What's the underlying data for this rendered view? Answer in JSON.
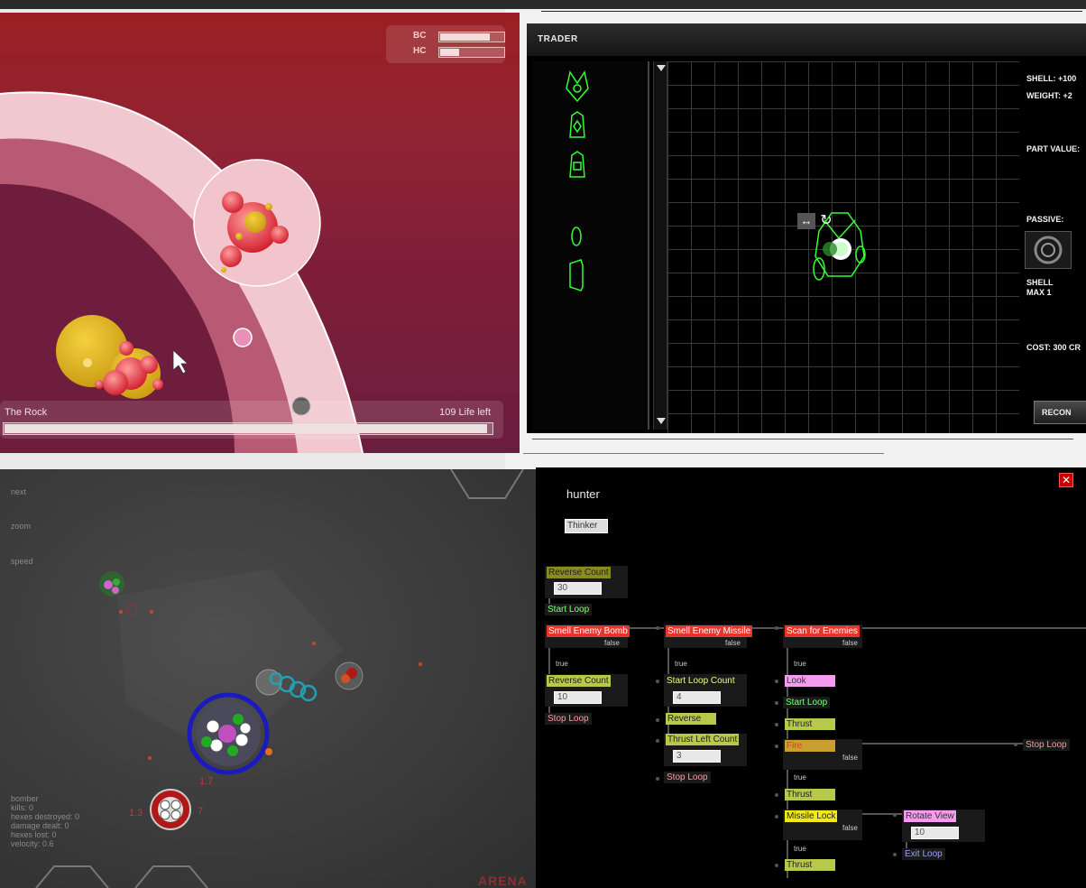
{
  "colors": {
    "trader_green": "#33ff33",
    "node_red": "#e8352a",
    "node_olive": "#8a8a22",
    "node_lime": "#b8c84a",
    "node_pink": "#f59cf0",
    "node_yellow": "#f2e81a",
    "node_orange": "#c8a030",
    "loop_green": "#7dff7d",
    "loop_pink": "#ff9aa0",
    "loop_blue": "#9aa0ff"
  },
  "rock_game": {
    "meter_bc_label": "BC",
    "meter_hc_label": "HC",
    "meter_bc_level": 0.78,
    "meter_hc_level": 0.3,
    "target_name": "The Rock",
    "life_text": "109 Life left",
    "life_level": 0.99
  },
  "trader": {
    "title": "TRADER",
    "shell": "SHELL: +100",
    "weight": "WEIGHT: +2",
    "part_value": "PART VALUE:",
    "passive": "PASSIVE:",
    "passive_name": "SHELL",
    "passive_max": "MAX 1",
    "cost": "COST: 300 CR",
    "recon_label": "RECON",
    "move_icon": "↔",
    "rotate_icon": "↻"
  },
  "arena": {
    "menu_next": "next",
    "menu_zoom": "zoom",
    "menu_speed": "speed",
    "stats": [
      "bomber",
      "kills: 0",
      "hexes destroyed: 0",
      "damage dealt: 0",
      "hexes lost: 0",
      "velocity: 0.6"
    ],
    "num_a": "1.7",
    "num_b": "1.3",
    "num_c": "7",
    "logo": "ARENA"
  },
  "ai_editor": {
    "title": "hunter",
    "thinker": "Thinker",
    "col1": {
      "reverse_count_1": "Reverse Count",
      "reverse_count_1_value": "30",
      "start_loop": "Start Loop",
      "smell_enemy_bomb": "Smell Enemy Bomb",
      "reverse_count_2": "Reverse Count",
      "reverse_count_2_value": "10",
      "stop_loop": "Stop Loop"
    },
    "col2": {
      "smell_enemy_missile": "Smell Enemy Missile",
      "start_loop_count": "Start Loop Count",
      "start_loop_count_value": "4",
      "reverse": "Reverse",
      "thrust_left_count": "Thrust Left Count",
      "thrust_left_count_value": "3",
      "stop_loop": "Stop Loop"
    },
    "col3": {
      "scan_for_enemies": "Scan for Enemies",
      "look": "Look",
      "start_loop": "Start Loop",
      "thrust_1": "Thrust",
      "fire": "Fire",
      "thrust_2": "Thrust",
      "missile_lock": "Missile Lock",
      "thrust_3": "Thrust"
    },
    "col4": {
      "stop_loop": "Stop Loop",
      "rotate_view": "Rotate View",
      "rotate_view_value": "10",
      "exit_loop": "Exit Loop"
    },
    "false_label": "false",
    "true_label": "true"
  }
}
